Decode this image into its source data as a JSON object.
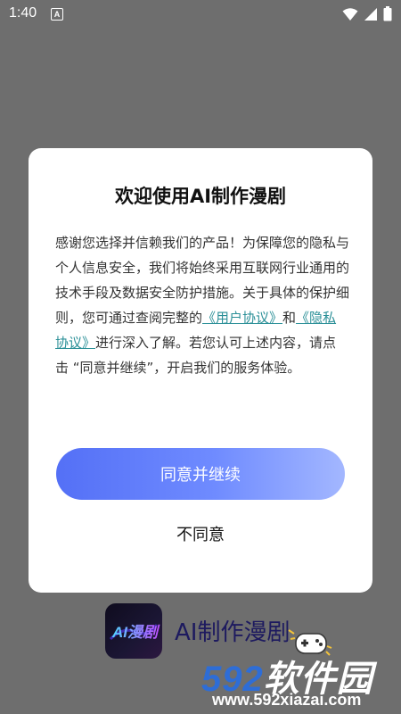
{
  "status_bar": {
    "time": "1:40",
    "notif_icon_letter": "A",
    "icons": [
      "wifi-icon",
      "signal-icon",
      "battery-icon"
    ]
  },
  "dialog": {
    "title": "欢迎使用AI制作漫剧",
    "body_before": "感谢您选择并信赖我们的产品！为保障您的隐私与个人信息安全，我们将始终采用互联网行业通用的技术手段及数据安全防护措施。关于具体的保护细则，您可通过查阅完整的",
    "user_agreement_link": "《用户协议》",
    "body_and": "和",
    "privacy_link": "《隐私协议》",
    "body_after": "进行深入了解。若您认可上述内容，请点击 “同意并继续”，开启我们的服务体验。",
    "agree_button": "同意并继续",
    "disagree_button": "不同意"
  },
  "app": {
    "name": "AI制作漫剧",
    "logo_text": "AI漫剧"
  },
  "watermark": {
    "digits": "592",
    "brand": "软件园",
    "url": "www.592xiazai.com"
  },
  "colors": {
    "overlay": "#6e6e6e",
    "link": "#2a8f97",
    "button_start": "#5470f6",
    "button_end": "#a3b7ff"
  }
}
